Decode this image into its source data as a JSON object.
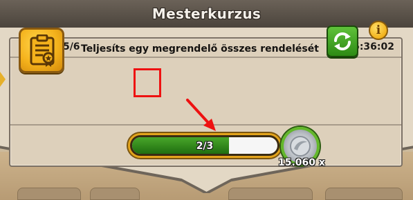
{
  "window": {
    "title": "Mesterkurzus"
  },
  "project": {
    "label": "Projekt 5/6",
    "timer": "65:36:02"
  },
  "task": {
    "icon": "clipboard-certificate-icon",
    "description": "Teljesíts egy megrendelő összes rendelését"
  },
  "buttons": {
    "refresh_icon": "refresh-icon",
    "info_label": "i"
  },
  "progress": {
    "text": "2/3",
    "fraction": 0.6667,
    "fill_color": "#2f8f1a"
  },
  "reward": {
    "icon": "silver-coin-icon",
    "amount": "15.060 x"
  },
  "colors": {
    "accent_gold": "#f2b21b",
    "accent_green": "#3aa321",
    "annotation_red": "#ee1111"
  }
}
